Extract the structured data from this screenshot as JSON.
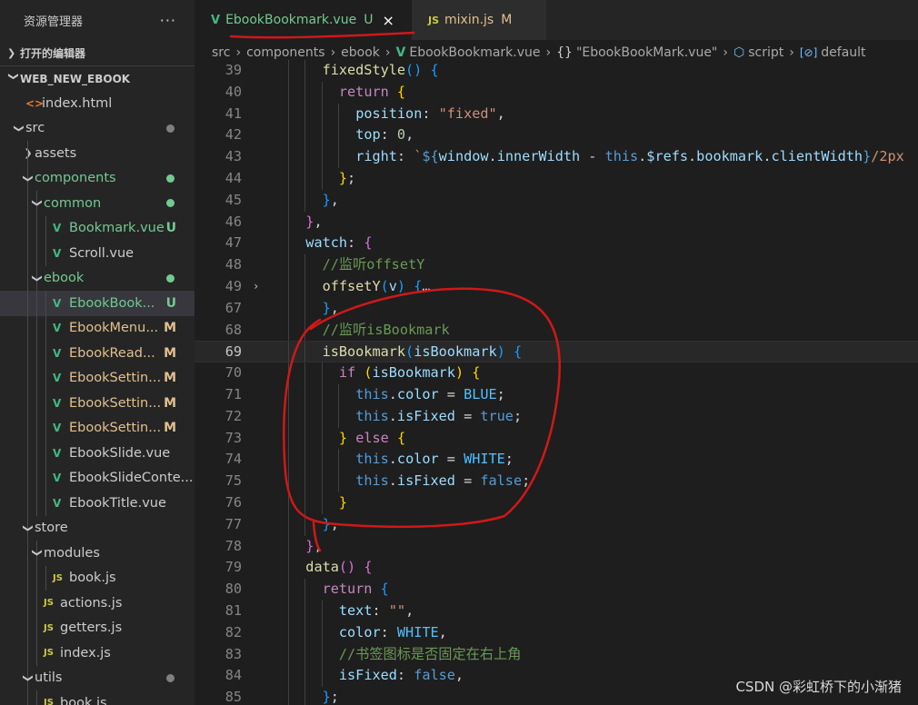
{
  "sidebar": {
    "title": "资源管理器",
    "more": "···",
    "open_editors": "打开的编辑器",
    "project": "WEB_NEW_EBOOK",
    "tree": [
      {
        "label": "index.html",
        "icon": "html",
        "depth": 1,
        "arrow": "",
        "status": "",
        "dot": ""
      },
      {
        "label": "src",
        "icon": "",
        "depth": 1,
        "arrow": "open",
        "status": "",
        "dot": "#808080"
      },
      {
        "label": "assets",
        "icon": "",
        "depth": 2,
        "arrow": "closed",
        "status": "",
        "dot": ""
      },
      {
        "label": "components",
        "icon": "",
        "depth": 2,
        "arrow": "open",
        "status": "",
        "dot": "#73c991",
        "color": "green"
      },
      {
        "label": "common",
        "icon": "",
        "depth": 3,
        "arrow": "open",
        "status": "",
        "dot": "#73c991",
        "color": "green"
      },
      {
        "label": "Bookmark.vue",
        "icon": "vue",
        "depth": 4,
        "arrow": "",
        "status": "U",
        "dot": "",
        "color": "green"
      },
      {
        "label": "Scroll.vue",
        "icon": "vue",
        "depth": 4,
        "arrow": "",
        "status": "",
        "dot": ""
      },
      {
        "label": "ebook",
        "icon": "",
        "depth": 3,
        "arrow": "open",
        "status": "",
        "dot": "#73c991",
        "color": "green"
      },
      {
        "label": "EbookBook...",
        "icon": "vue",
        "depth": 4,
        "arrow": "",
        "status": "U",
        "dot": "",
        "color": "green",
        "active": true
      },
      {
        "label": "EbookMenu...",
        "icon": "vue",
        "depth": 4,
        "arrow": "",
        "status": "M",
        "dot": "",
        "color": "mod"
      },
      {
        "label": "EbookRead...",
        "icon": "vue",
        "depth": 4,
        "arrow": "",
        "status": "M",
        "dot": "",
        "color": "mod"
      },
      {
        "label": "EbookSettin...",
        "icon": "vue",
        "depth": 4,
        "arrow": "",
        "status": "M",
        "dot": "",
        "color": "mod"
      },
      {
        "label": "EbookSettin...",
        "icon": "vue",
        "depth": 4,
        "arrow": "",
        "status": "M",
        "dot": "",
        "color": "mod"
      },
      {
        "label": "EbookSettin...",
        "icon": "vue",
        "depth": 4,
        "arrow": "",
        "status": "M",
        "dot": "",
        "color": "mod"
      },
      {
        "label": "EbookSlide.vue",
        "icon": "vue",
        "depth": 4,
        "arrow": "",
        "status": "",
        "dot": ""
      },
      {
        "label": "EbookSlideConte...",
        "icon": "vue",
        "depth": 4,
        "arrow": "",
        "status": "",
        "dot": ""
      },
      {
        "label": "EbookTitle.vue",
        "icon": "vue",
        "depth": 4,
        "arrow": "",
        "status": "",
        "dot": ""
      },
      {
        "label": "store",
        "icon": "",
        "depth": 2,
        "arrow": "open",
        "status": "",
        "dot": ""
      },
      {
        "label": "modules",
        "icon": "",
        "depth": 3,
        "arrow": "open",
        "status": "",
        "dot": ""
      },
      {
        "label": "book.js",
        "icon": "js",
        "depth": 4,
        "arrow": "",
        "status": "",
        "dot": ""
      },
      {
        "label": "actions.js",
        "icon": "js",
        "depth": 3,
        "arrow": "",
        "status": "",
        "dot": ""
      },
      {
        "label": "getters.js",
        "icon": "js",
        "depth": 3,
        "arrow": "",
        "status": "",
        "dot": ""
      },
      {
        "label": "index.js",
        "icon": "js",
        "depth": 3,
        "arrow": "",
        "status": "",
        "dot": ""
      },
      {
        "label": "utils",
        "icon": "",
        "depth": 2,
        "arrow": "open",
        "status": "",
        "dot": "#808080"
      },
      {
        "label": "book.js",
        "icon": "js",
        "depth": 3,
        "arrow": "",
        "status": "",
        "dot": ""
      }
    ]
  },
  "tabs": [
    {
      "label": "EbookBookmark.vue",
      "status": "U",
      "icon": "V",
      "active": true,
      "close": "×"
    },
    {
      "label": "mixin.js",
      "status": "M",
      "icon": "JS",
      "active": false
    }
  ],
  "breadcrumbs": {
    "src": "src",
    "components": "components",
    "ebook": "ebook",
    "file": "EbookBookmark.vue",
    "component": "\"EbookBookMark.vue\"",
    "script": "script",
    "default": "default"
  },
  "code": {
    "current_line": 69,
    "lines": [
      {
        "n": 39,
        "indent": 1,
        "tokens": [
          [
            "fn",
            "fixedStyle"
          ],
          [
            "b3",
            "()"
          ],
          [
            "wt",
            " "
          ],
          [
            "b3",
            "{"
          ]
        ]
      },
      {
        "n": 40,
        "indent": 2,
        "tokens": [
          [
            "kw",
            "return"
          ],
          [
            "wt",
            " "
          ],
          [
            "b1",
            "{"
          ]
        ]
      },
      {
        "n": 41,
        "indent": 3,
        "tokens": [
          [
            "prop",
            "position"
          ],
          [
            "wt",
            ": "
          ],
          [
            "str",
            "\"fixed\""
          ],
          [
            "wt",
            ","
          ]
        ]
      },
      {
        "n": 42,
        "indent": 3,
        "tokens": [
          [
            "prop",
            "top"
          ],
          [
            "wt",
            ": "
          ],
          [
            "num",
            "0"
          ],
          [
            "wt",
            ","
          ]
        ]
      },
      {
        "n": 43,
        "indent": 3,
        "tokens": [
          [
            "prop",
            "right"
          ],
          [
            "wt",
            ": "
          ],
          [
            "str",
            "`"
          ],
          [
            "thk",
            "${"
          ],
          [
            "prop",
            "window"
          ],
          [
            "wt",
            "."
          ],
          [
            "prop",
            "innerWidth"
          ],
          [
            "wt",
            " - "
          ],
          [
            "thk",
            "this"
          ],
          [
            "wt",
            "."
          ],
          [
            "prop",
            "$refs"
          ],
          [
            "wt",
            "."
          ],
          [
            "prop",
            "bookmark"
          ],
          [
            "wt",
            "."
          ],
          [
            "prop",
            "clientWidth"
          ],
          [
            "thk",
            "}"
          ],
          [
            "str",
            "/2px"
          ]
        ]
      },
      {
        "n": 44,
        "indent": 2,
        "tokens": [
          [
            "b1",
            "}"
          ],
          [
            "wt",
            ";"
          ]
        ]
      },
      {
        "n": 45,
        "indent": 1,
        "tokens": [
          [
            "b3",
            "}"
          ],
          [
            "wt",
            ","
          ]
        ]
      },
      {
        "n": 46,
        "indent": 0,
        "tokens": [
          [
            "b2",
            "}"
          ],
          [
            "wt",
            ","
          ]
        ]
      },
      {
        "n": 47,
        "indent": 0,
        "tokens": [
          [
            "prop",
            "watch"
          ],
          [
            "wt",
            ": "
          ],
          [
            "b2",
            "{"
          ]
        ]
      },
      {
        "n": 48,
        "indent": 1,
        "tokens": [
          [
            "cmt",
            "//监听offsetY"
          ]
        ]
      },
      {
        "n": 49,
        "indent": 1,
        "fold": "›",
        "tokens": [
          [
            "fn",
            "offsetY"
          ],
          [
            "b3",
            "("
          ],
          [
            "prop",
            "v"
          ],
          [
            "b3",
            ")"
          ],
          [
            "wt",
            " "
          ],
          [
            "b3",
            "{"
          ],
          [
            "wt",
            "…"
          ]
        ]
      },
      {
        "n": 67,
        "indent": 1,
        "tokens": [
          [
            "b3",
            "}"
          ],
          [
            "wt",
            ","
          ]
        ]
      },
      {
        "n": 68,
        "indent": 1,
        "tokens": [
          [
            "cmt",
            "//监听isBookmark"
          ]
        ]
      },
      {
        "n": 69,
        "indent": 1,
        "tokens": [
          [
            "fn",
            "isBookmark"
          ],
          [
            "b3",
            "("
          ],
          [
            "prop",
            "isBookmark"
          ],
          [
            "b3",
            ")"
          ],
          [
            "wt",
            " "
          ],
          [
            "b3",
            "{"
          ]
        ]
      },
      {
        "n": 70,
        "indent": 2,
        "tokens": [
          [
            "kw",
            "if"
          ],
          [
            "wt",
            " "
          ],
          [
            "b1",
            "("
          ],
          [
            "prop",
            "isBookmark"
          ],
          [
            "b1",
            ")"
          ],
          [
            "wt",
            " "
          ],
          [
            "b1",
            "{"
          ]
        ]
      },
      {
        "n": 71,
        "indent": 3,
        "tokens": [
          [
            "thk",
            "this"
          ],
          [
            "wt",
            "."
          ],
          [
            "prop",
            "color"
          ],
          [
            "wt",
            " = "
          ],
          [
            "cst",
            "BLUE"
          ],
          [
            "wt",
            ";"
          ]
        ]
      },
      {
        "n": 72,
        "indent": 3,
        "tokens": [
          [
            "thk",
            "this"
          ],
          [
            "wt",
            "."
          ],
          [
            "prop",
            "isFixed"
          ],
          [
            "wt",
            " = "
          ],
          [
            "thk",
            "true"
          ],
          [
            "wt",
            ";"
          ]
        ]
      },
      {
        "n": 73,
        "indent": 2,
        "tokens": [
          [
            "b1",
            "}"
          ],
          [
            "wt",
            " "
          ],
          [
            "kw",
            "else"
          ],
          [
            "wt",
            " "
          ],
          [
            "b1",
            "{"
          ]
        ]
      },
      {
        "n": 74,
        "indent": 3,
        "tokens": [
          [
            "thk",
            "this"
          ],
          [
            "wt",
            "."
          ],
          [
            "prop",
            "color"
          ],
          [
            "wt",
            " = "
          ],
          [
            "cst",
            "WHITE"
          ],
          [
            "wt",
            ";"
          ]
        ]
      },
      {
        "n": 75,
        "indent": 3,
        "tokens": [
          [
            "thk",
            "this"
          ],
          [
            "wt",
            "."
          ],
          [
            "prop",
            "isFixed"
          ],
          [
            "wt",
            " = "
          ],
          [
            "thk",
            "false"
          ],
          [
            "wt",
            ";"
          ]
        ]
      },
      {
        "n": 76,
        "indent": 2,
        "tokens": [
          [
            "b1",
            "}"
          ]
        ]
      },
      {
        "n": 77,
        "indent": 1,
        "tokens": [
          [
            "b3",
            "}"
          ],
          [
            "wt",
            ","
          ]
        ]
      },
      {
        "n": 78,
        "indent": 0,
        "tokens": [
          [
            "b2",
            "}"
          ],
          [
            "wt",
            ","
          ]
        ]
      },
      {
        "n": 79,
        "indent": 0,
        "tokens": [
          [
            "fn",
            "data"
          ],
          [
            "b2",
            "()"
          ],
          [
            "wt",
            " "
          ],
          [
            "b2",
            "{"
          ]
        ]
      },
      {
        "n": 80,
        "indent": 1,
        "tokens": [
          [
            "kw",
            "return"
          ],
          [
            "wt",
            " "
          ],
          [
            "b3",
            "{"
          ]
        ]
      },
      {
        "n": 81,
        "indent": 2,
        "tokens": [
          [
            "prop",
            "text"
          ],
          [
            "wt",
            ": "
          ],
          [
            "str",
            "\"\""
          ],
          [
            "wt",
            ","
          ]
        ]
      },
      {
        "n": 82,
        "indent": 2,
        "tokens": [
          [
            "prop",
            "color"
          ],
          [
            "wt",
            ": "
          ],
          [
            "cst",
            "WHITE"
          ],
          [
            "wt",
            ","
          ]
        ]
      },
      {
        "n": 83,
        "indent": 2,
        "tokens": [
          [
            "cmt",
            "//书签图标是否固定在右上角"
          ]
        ]
      },
      {
        "n": 84,
        "indent": 2,
        "tokens": [
          [
            "prop",
            "isFixed"
          ],
          [
            "wt",
            ": "
          ],
          [
            "thk",
            "false"
          ],
          [
            "wt",
            ","
          ]
        ]
      },
      {
        "n": 85,
        "indent": 1,
        "tokens": [
          [
            "b3",
            "}"
          ],
          [
            "wt",
            ";"
          ]
        ]
      }
    ]
  },
  "watermark": "CSDN @彩虹桥下的小渐猪",
  "colors": {
    "annotation": "#d01818",
    "vue_green": "#41b883",
    "untracked": "#73c991",
    "modified": "#e2c08d"
  }
}
